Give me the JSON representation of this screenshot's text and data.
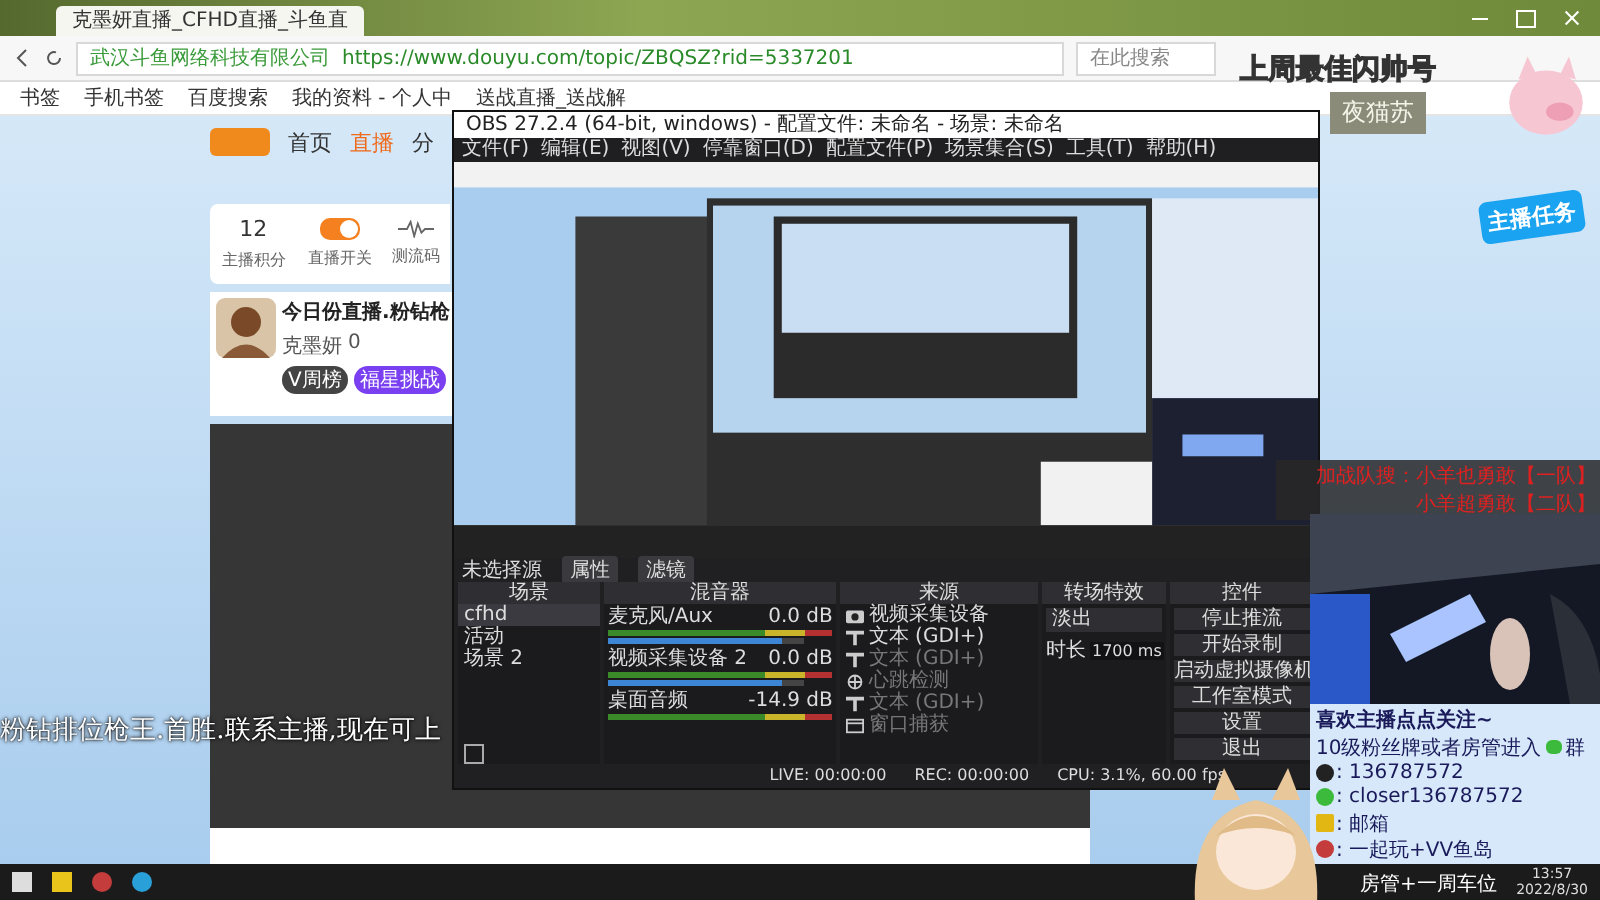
{
  "browser": {
    "tab_title": "克墨妍直播_CFHD直播_斗鱼直",
    "site_owner": "武汉斗鱼网络科技有限公司",
    "url": "https://www.douyu.com/topic/ZBQSZ?rid=5337201",
    "search": {
      "placeholder": "在此搜索"
    },
    "bookmarks": [
      "书签",
      "手机书签",
      "百度搜索",
      "我的资料 - 个人中",
      "送战直播_送战解"
    ]
  },
  "site": {
    "nav": [
      {
        "label": "首页",
        "selected": false
      },
      {
        "label": "直播",
        "selected": true
      },
      {
        "label": "分",
        "selected": false
      }
    ],
    "stats": [
      {
        "kind": "number",
        "value": "12",
        "label": "主播积分"
      },
      {
        "kind": "toggle",
        "on": true,
        "label": "直播开关"
      },
      {
        "kind": "wave",
        "label": "测流码"
      }
    ],
    "room": {
      "title": "今日份直播.粉钻枪",
      "host": "克墨妍",
      "heat": "0",
      "weekly": "V周榜",
      "challenge": "福星挑战"
    },
    "task_badge": "主播任务"
  },
  "obs": {
    "title": "OBS 27.2.4 (64-bit, windows) - 配置文件: 未命名 - 场景: 未命名",
    "menu": [
      "文件(F)",
      "编辑(E)",
      "视图(V)",
      "停靠窗口(D)",
      "配置文件(P)",
      "场景集合(S)",
      "工具(T)",
      "帮助(H)"
    ],
    "source_bar": {
      "label": "未选择源",
      "buttons": [
        "属性",
        "滤镜"
      ]
    },
    "scenes": {
      "title": "场景",
      "items": [
        {
          "label": "cfhd",
          "selected": true
        },
        {
          "label": "活动",
          "selected": false
        },
        {
          "label": "场景 2",
          "selected": false
        }
      ]
    },
    "mixer": {
      "title": "混音器",
      "channels": [
        {
          "name": "麦克风/Aux",
          "reading": "0.0 dB",
          "level": 0.88
        },
        {
          "name": "视频采集设备 2",
          "reading": "0.0 dB",
          "level": 0.88
        },
        {
          "name": "桌面音频",
          "reading": "-14.9 dB"
        }
      ]
    },
    "sources": {
      "title": "来源",
      "items": [
        {
          "kind": "camera",
          "label": "视频采集设备",
          "visible": true
        },
        {
          "kind": "text",
          "label": "文本 (GDI+)",
          "visible": true
        },
        {
          "kind": "text",
          "label": "文本 (GDI+)",
          "visible": false
        },
        {
          "kind": "browser",
          "label": "心跳检测",
          "visible": false
        },
        {
          "kind": "text",
          "label": "文本 (GDI+)",
          "visible": false
        },
        {
          "kind": "window",
          "label": "窗口捕获",
          "visible": false
        }
      ]
    },
    "transitions": {
      "title": "转场特效",
      "type": "淡出",
      "duration_label": "时长",
      "duration": "1700 ms"
    },
    "controls": {
      "title": "控件",
      "buttons": [
        "停止推流",
        "开始录制",
        "启动虚拟摄像机",
        "工作室模式",
        "设置",
        "退出"
      ]
    },
    "status": {
      "live": "LIVE: 00:00:00",
      "rec": "REC: 00:00:00",
      "cpu": "CPU: 3.1%, 60.00 fps"
    }
  },
  "overlay": {
    "ticker": "粉钻排位枪王.首胜.联系主播,现在可上",
    "banner": "上周最佳闪帅号",
    "badge": "夜猫苏",
    "team_lines": [
      "加战队搜：小羊也勇敢【一队】",
      "小羊超勇敢【二队】"
    ],
    "info": {
      "heading": "喜欢主播点点关注~",
      "group_line": "10级粉丝牌或者房管进入",
      "group_suffix": "群",
      "lines": [
        {
          "kind": "qq",
          "text": ": 136787572"
        },
        {
          "kind": "wechat",
          "text": ": closer136787572"
        },
        {
          "kind": "gold",
          "text": ": 邮箱"
        },
        {
          "kind": "game",
          "text": ": 一起玩+VV鱼岛"
        }
      ]
    },
    "footer": "房管+一周车位"
  },
  "taskbar": {
    "time": "13:57",
    "date": "2022/8/30"
  }
}
